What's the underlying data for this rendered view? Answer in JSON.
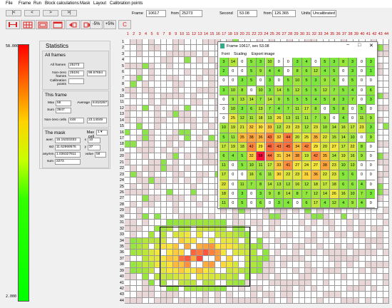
{
  "menu": [
    "File",
    "Frame",
    "Run",
    "Block calculations",
    "Mask",
    "Layout",
    "Calibration points"
  ],
  "nav_buttons": [
    "|<",
    "<",
    ">",
    ">|"
  ],
  "toolbar": {
    "frame_label": "Frame",
    "frame_value": "10617",
    "from_label": "from",
    "frame_total": "25273",
    "second_label": "Second",
    "second_value": "53.08",
    "from2_label": "from",
    "second_total": "126.365",
    "units_label": "Units",
    "units_value": "Uncalibrated",
    "zoom_minus": "-5%",
    "zoom_plus": "+5%",
    "refresh": "C"
  },
  "colorbar": {
    "max_label": "58.000",
    "min_label": "2.000"
  },
  "stats": {
    "title": "Statistics",
    "all_frames": {
      "title": "All frames",
      "all_frames_label": "All frames",
      "all_frames_value": "25273",
      "nonzero_label": "Non-zero frames",
      "nonzero_value": "25191",
      "nonzero_pct": "99.67654",
      "calib_label": "Calibration points",
      "calib_value": ""
    },
    "this_frame": {
      "title": "This frame",
      "max_label": "Max",
      "max_value": "58",
      "avg_label": "Average",
      "avg_value": "8.810267",
      "sum_label": "Sum",
      "sum_value": "3947",
      "nz_label": "Non-zero cells",
      "nz_value": "448",
      "nz_pct": "23.14049"
    },
    "mask": {
      "title": "The mask",
      "maxcell_label": "Max cell",
      "maxcell_value": "1",
      "aver_label": "aver.",
      "aver_value": "15.15333333",
      "std_label": "std",
      "std_value": "11.62969576",
      "asym_label": "asymm.",
      "asym_value": "1.036327811",
      "sum_label": "sum",
      "sum_value": "2273",
      "x_label": "x",
      "x_value": "10",
      "y_label": "y",
      "y_value": "37",
      "value_label": "value",
      "value_value": "58"
    }
  },
  "grid": {
    "columns": [
      "1",
      "2",
      "3",
      "4",
      "5",
      "6",
      "7",
      "8",
      "9",
      "10",
      "11",
      "12",
      "13",
      "14",
      "15",
      "16",
      "17",
      "18",
      "19",
      "20",
      "21",
      "22",
      "23",
      "24",
      "25",
      "26",
      "27",
      "28",
      "29",
      "30",
      "31",
      "32",
      "33",
      "34",
      "35",
      "36",
      "37",
      "38",
      "39",
      "40",
      "41",
      "42",
      "43",
      "44"
    ],
    "rows": [
      "1",
      "2",
      "3",
      "4",
      "5",
      "6",
      "7",
      "8",
      "9",
      "10",
      "11",
      "12",
      "13",
      "14",
      "15",
      "16",
      "17",
      "18",
      "19",
      "20",
      "21",
      "22",
      "23",
      "24",
      "25",
      "26",
      "27",
      "28",
      "29",
      "30",
      "31",
      "32",
      "33",
      "34",
      "35",
      "36",
      "37",
      "38",
      "39",
      "40",
      "41",
      "42",
      "43",
      "44"
    ]
  },
  "window": {
    "title": "Frame 10617, sec 53.08",
    "menu": [
      "Font",
      "Scaling",
      "Export image"
    ],
    "rows": [
      [
        "3",
        "14",
        "0",
        "5",
        "3",
        "10",
        "0",
        "0",
        "3",
        "4",
        "0",
        "5",
        "3",
        "8",
        "3",
        "0",
        "3"
      ],
      [
        "2",
        "0",
        "0",
        "5",
        "9",
        "4",
        "4",
        "0",
        "8",
        "6",
        "12",
        "4",
        "5",
        "0",
        "3",
        "0",
        "1"
      ],
      [
        "0",
        "0",
        "3",
        "5",
        "0",
        "3",
        "0",
        "5",
        "10",
        "5",
        "3",
        "9",
        "6",
        "0",
        "5",
        "0",
        "0"
      ],
      [
        "3",
        "10",
        "8",
        "0",
        "10",
        "3",
        "14",
        "5",
        "12",
        "5",
        "5",
        "12",
        "7",
        "5",
        "4",
        "0",
        "6"
      ],
      [
        "0",
        "9",
        "13",
        "14",
        "7",
        "14",
        "9",
        "5",
        "5",
        "5",
        "4",
        "5",
        "8",
        "3",
        "7",
        "0",
        "3"
      ],
      [
        "0",
        "10",
        "3",
        "6",
        "13",
        "7",
        "4",
        "7",
        "11",
        "17",
        "8",
        "0",
        "5",
        "8",
        "0",
        "5",
        "0"
      ],
      [
        "0",
        "25",
        "12",
        "11",
        "18",
        "13",
        "26",
        "13",
        "11",
        "11",
        "7",
        "9",
        "0",
        "4",
        "0",
        "11",
        "9"
      ],
      [
        "10",
        "19",
        "21",
        "32",
        "30",
        "33",
        "12",
        "23",
        "23",
        "12",
        "23",
        "10",
        "14",
        "16",
        "17",
        "23",
        "3"
      ],
      [
        "5",
        "11",
        "35",
        "38",
        "36",
        "43",
        "32",
        "44",
        "20",
        "25",
        "35",
        "22",
        "15",
        "14",
        "10",
        "0",
        "9"
      ],
      [
        "17",
        "19",
        "18",
        "42",
        "29",
        "46",
        "43",
        "45",
        "34",
        "42",
        "29",
        "20",
        "27",
        "17",
        "22",
        "8",
        "0"
      ],
      [
        "6",
        "4",
        "5",
        "32",
        "58",
        "44",
        "31",
        "34",
        "38",
        "19",
        "42",
        "35",
        "14",
        "19",
        "16",
        "9",
        "0"
      ],
      [
        "11",
        "0",
        "5",
        "10",
        "11",
        "17",
        "33",
        "41",
        "27",
        "24",
        "27",
        "38",
        "23",
        "10",
        "13",
        "0",
        "0"
      ],
      [
        "17",
        "0",
        "0",
        "16",
        "6",
        "11",
        "30",
        "22",
        "23",
        "31",
        "36",
        "22",
        "23",
        "5",
        "6",
        "0",
        "0"
      ],
      [
        "22",
        "0",
        "11",
        "7",
        "8",
        "14",
        "13",
        "12",
        "16",
        "12",
        "18",
        "17",
        "18",
        "6",
        "6",
        "4",
        "0"
      ],
      [
        "18",
        "0",
        "3",
        "0",
        "3",
        "9",
        "8",
        "14",
        "8",
        "7",
        "12",
        "14",
        "26",
        "16",
        "10",
        "7",
        "3"
      ],
      [
        "11",
        "0",
        "5",
        "0",
        "6",
        "0",
        "3",
        "4",
        "0",
        "6",
        "17",
        "4",
        "12",
        "4",
        "9",
        "4",
        "0"
      ]
    ]
  }
}
